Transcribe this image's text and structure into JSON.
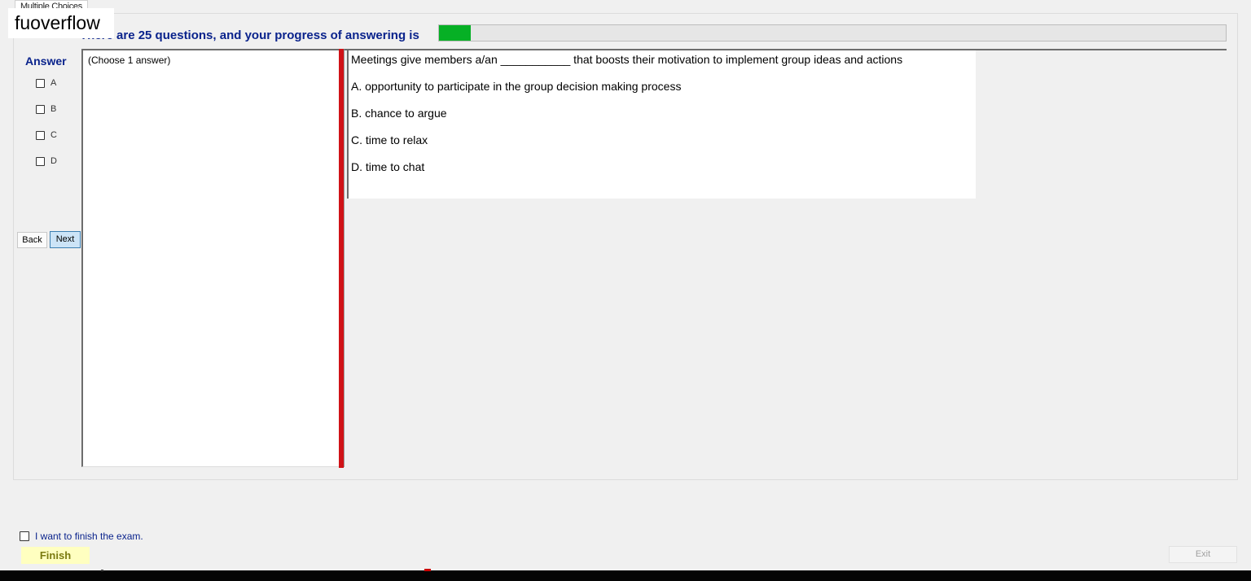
{
  "tab": {
    "label": "Multiple Choices"
  },
  "watermark": "fuoverflow",
  "progress": {
    "text": "There are 25 questions, and your progress of answering is",
    "fraction": 0.04
  },
  "answer_panel": {
    "title": "Answer",
    "options": [
      "A",
      "B",
      "C",
      "D"
    ],
    "back_label": "Back",
    "next_label": "Next"
  },
  "left_box": {
    "instruction": "(Choose 1 answer)"
  },
  "question": {
    "text": "Meetings give members a/an ___________ that boosts their motivation to implement group ideas and actions",
    "choices": [
      "A.  opportunity to participate in the group decision making process",
      "B.  chance to argue",
      "C.  time to relax",
      "D.  time to chat"
    ]
  },
  "footer": {
    "finish_check_label": "I want to finish the exam.",
    "finish_label": "Finish",
    "exit_label": "Exit"
  },
  "colors": {
    "accent_text": "#0a238c",
    "progress_fill": "#06b025",
    "splitter": "#d01217",
    "finish_bg": "#ffffc0"
  }
}
